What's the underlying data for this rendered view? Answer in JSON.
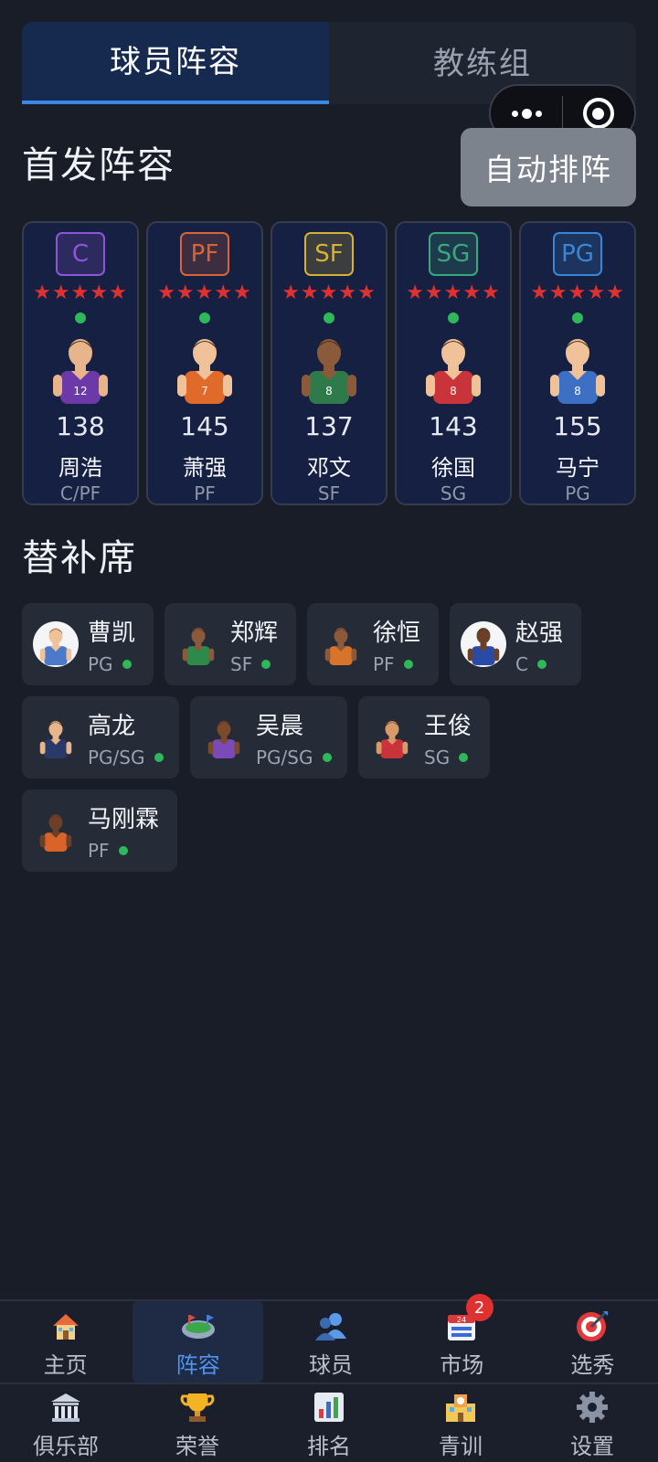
{
  "tabs": [
    {
      "label": "球员阵容",
      "active": true
    },
    {
      "label": "教练组",
      "active": false
    }
  ],
  "capsule": {
    "more_icon": "more-dots-icon",
    "close_icon": "target-icon"
  },
  "starters": {
    "title": "首发阵容",
    "auto_button": "自动排阵",
    "players": [
      {
        "badge": "C",
        "badge_color": "#8e55d6",
        "stars": "★★★★★",
        "rating": "138",
        "name": "周浩",
        "pos": "C/PF",
        "jersey": "#6b3aa8",
        "skin": "#e8b48c",
        "number": "12"
      },
      {
        "badge": "PF",
        "badge_color": "#d8643a",
        "stars": "★★★★★",
        "rating": "145",
        "name": "萧强",
        "pos": "PF",
        "jersey": "#e06a2a",
        "skin": "#f0c29a",
        "number": "7"
      },
      {
        "badge": "SF",
        "badge_color": "#d6b232",
        "stars": "★★★★★",
        "rating": "137",
        "name": "邓文",
        "pos": "SF",
        "jersey": "#2e7a4a",
        "skin": "#8a5a3a",
        "number": "8"
      },
      {
        "badge": "SG",
        "badge_color": "#3aa87a",
        "stars": "★★★★★",
        "rating": "143",
        "name": "徐国",
        "pos": "SG",
        "jersey": "#c8343a",
        "skin": "#f0c29a",
        "number": "8"
      },
      {
        "badge": "PG",
        "badge_color": "#3a86d6",
        "stars": "★★★★★",
        "rating": "155",
        "name": "马宁",
        "pos": "PG",
        "jersey": "#3d6fc4",
        "skin": "#f0c29a",
        "number": "8"
      }
    ]
  },
  "bench": {
    "title": "替补席",
    "rows": [
      [
        {
          "name": "曹凯",
          "pos": "PG",
          "jersey": "#4a7ac8",
          "skin": "#f0c29a",
          "white_bg": true,
          "width": 144
        },
        {
          "name": "郑辉",
          "pos": "SF",
          "jersey": "#2e8a4a",
          "skin": "#8a5a3a",
          "white_bg": false,
          "width": 144
        },
        {
          "name": "徐恒",
          "pos": "PF",
          "jersey": "#d8742a",
          "skin": "#8a5a3a",
          "white_bg": false,
          "width": 144
        },
        {
          "name": "赵强",
          "pos": "C",
          "jersey": "#2a4aa8",
          "skin": "#6a4028",
          "white_bg": true,
          "width": 144
        }
      ],
      [
        {
          "name": "高龙",
          "pos": "PG/SG",
          "jersey": "#2a3a68",
          "skin": "#e8b48c",
          "white_bg": false,
          "width": 172
        },
        {
          "name": "吴晨",
          "pos": "PG/SG",
          "jersey": "#7a4ab8",
          "skin": "#7a4a2a",
          "white_bg": false,
          "width": 172
        },
        {
          "name": "王俊",
          "pos": "SG",
          "jersey": "#c8343a",
          "skin": "#d89a6a",
          "white_bg": false,
          "width": 144
        }
      ],
      [
        {
          "name": "马刚霖",
          "pos": "PF",
          "jersey": "#d8642a",
          "skin": "#6a4028",
          "white_bg": false,
          "width": 170
        }
      ]
    ]
  },
  "nav": {
    "row1": [
      {
        "label": "主页",
        "icon": "house-icon",
        "active": false
      },
      {
        "label": "阵容",
        "icon": "stadium-icon",
        "active": true
      },
      {
        "label": "球员",
        "icon": "people-icon",
        "active": false
      },
      {
        "label": "市场",
        "icon": "calendar-store-icon",
        "active": false,
        "badge": "2"
      },
      {
        "label": "选秀",
        "icon": "target-dart-icon",
        "active": false
      }
    ],
    "row2": [
      {
        "label": "俱乐部",
        "icon": "bank-building-icon",
        "active": false
      },
      {
        "label": "荣誉",
        "icon": "trophy-icon",
        "active": false
      },
      {
        "label": "排名",
        "icon": "bar-chart-icon",
        "active": false
      },
      {
        "label": "青训",
        "icon": "school-icon",
        "active": false
      },
      {
        "label": "设置",
        "icon": "gear-icon",
        "active": false
      }
    ]
  }
}
